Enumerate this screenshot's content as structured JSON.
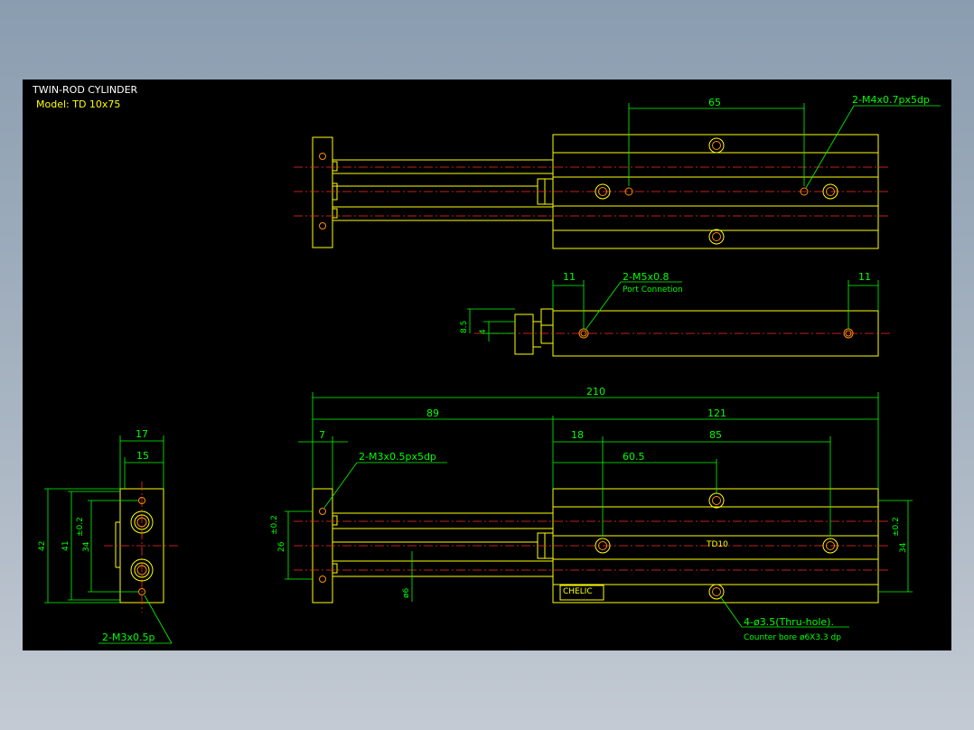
{
  "title_block": {
    "title": "TWIN-ROD CYLINDER",
    "model": "Model:  TD 10x75"
  },
  "colors": {
    "background": "#000000",
    "outline": "#ffff00",
    "dimension": "#00ff00",
    "centerline": "#ff2a2a",
    "hole": "#ff8c00",
    "text": "#ffffff"
  },
  "dimensions": {
    "top_view": {
      "d65": "65",
      "note_top": "2-M4x0.7px5dp"
    },
    "side_view": {
      "d11_left": "11",
      "d11_right": "11",
      "port_note": "2-M5x0.8",
      "port_note2": "Port Connetion",
      "d85": "8.5",
      "d4": "4"
    },
    "front_view": {
      "d210": "210",
      "d89": "89",
      "d121": "121",
      "d7": "7",
      "d18": "18",
      "d85": "85",
      "d60_5": "60.5",
      "note_m3": "2-M3x0.5px5dp",
      "d26": "26",
      "d26_tol": "±0.2",
      "d34": "34",
      "d34_tol": "±0.2",
      "d6": "ø6",
      "note_holes": "4-ø3.5(Thru-hole).",
      "note_bore": "Counter bore ø6X3.3 dp",
      "label_small": "TD10",
      "nameplate": "CHELIC"
    },
    "end_view": {
      "d17": "17",
      "d15": "15",
      "d42": "42",
      "d41": "41",
      "d34": "34",
      "d34_tol": "±0.2",
      "note_bottom": "2-M3x0.5p"
    }
  }
}
